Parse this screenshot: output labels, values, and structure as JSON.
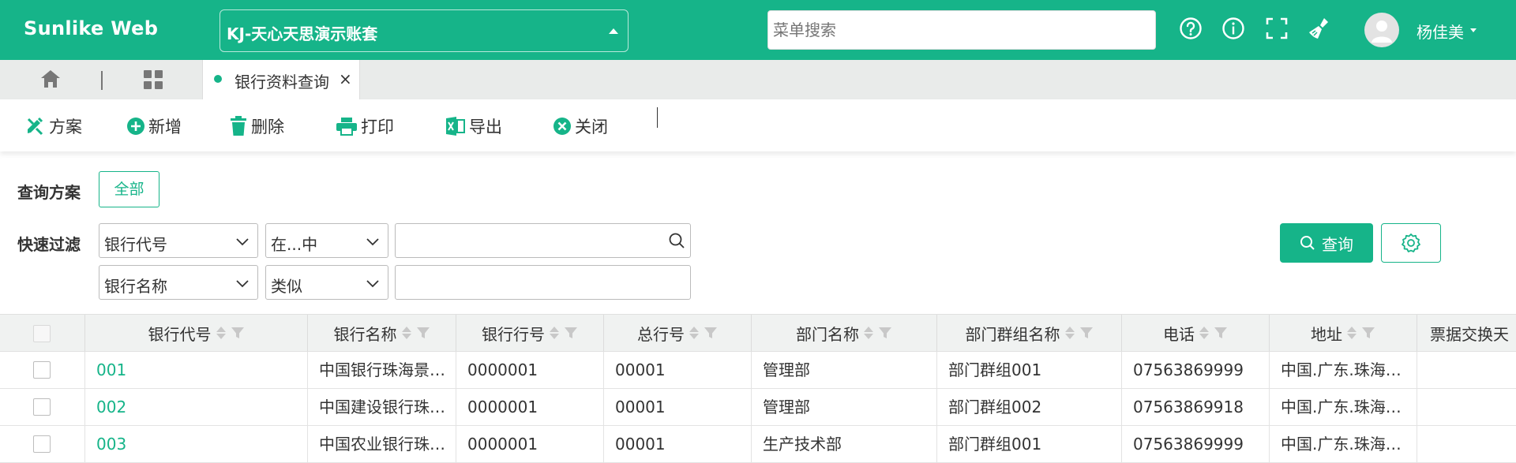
{
  "header": {
    "logo": "Sunlike Web",
    "account": "KJ-天心天思演示账套",
    "menu_search_placeholder": "菜单搜索",
    "username": "杨佳美",
    "icons": [
      "help-circle-icon",
      "info-circle-icon",
      "fullscreen-icon",
      "broom-icon"
    ],
    "bg_color": "#16b489"
  },
  "tabs": {
    "active": "银行资料查询",
    "close": "×"
  },
  "toolbar": {
    "scheme": "方案",
    "add": "新增",
    "delete": "删除",
    "print": "打印",
    "export": "导出",
    "close": "关闭"
  },
  "query": {
    "scheme_label": "查询方案",
    "scheme_all": "全部",
    "filter_label": "快速过滤",
    "filter1_field": "银行代号",
    "filter1_op": "在...中",
    "filter1_value": "",
    "filter2_field": "银行名称",
    "filter2_op": "类似",
    "filter2_value": "",
    "query_button": "查询"
  },
  "table": {
    "columns": [
      "银行代号",
      "银行名称",
      "银行行号",
      "总行号",
      "部门名称",
      "部门群组名称",
      "电话",
      "地址",
      "票据交换天"
    ],
    "rows": [
      [
        "001",
        "中国银行珠海景山路支行",
        "0000001",
        "00001",
        "管理部",
        "部门群组001",
        "07563869999",
        "中国.广东.珠海市香洲区",
        ""
      ],
      [
        "002",
        "中国建设银行珠海分行",
        "0000001",
        "00001",
        "管理部",
        "部门群组002",
        "07563869918",
        "中国.广东.珠海市香洲区",
        ""
      ],
      [
        "003",
        "中国农业银行珠海分行",
        "0000001",
        "00001",
        "生产技术部",
        "部门群组001",
        "07563869999",
        "中国.广东.珠海市香洲区",
        ""
      ]
    ]
  }
}
